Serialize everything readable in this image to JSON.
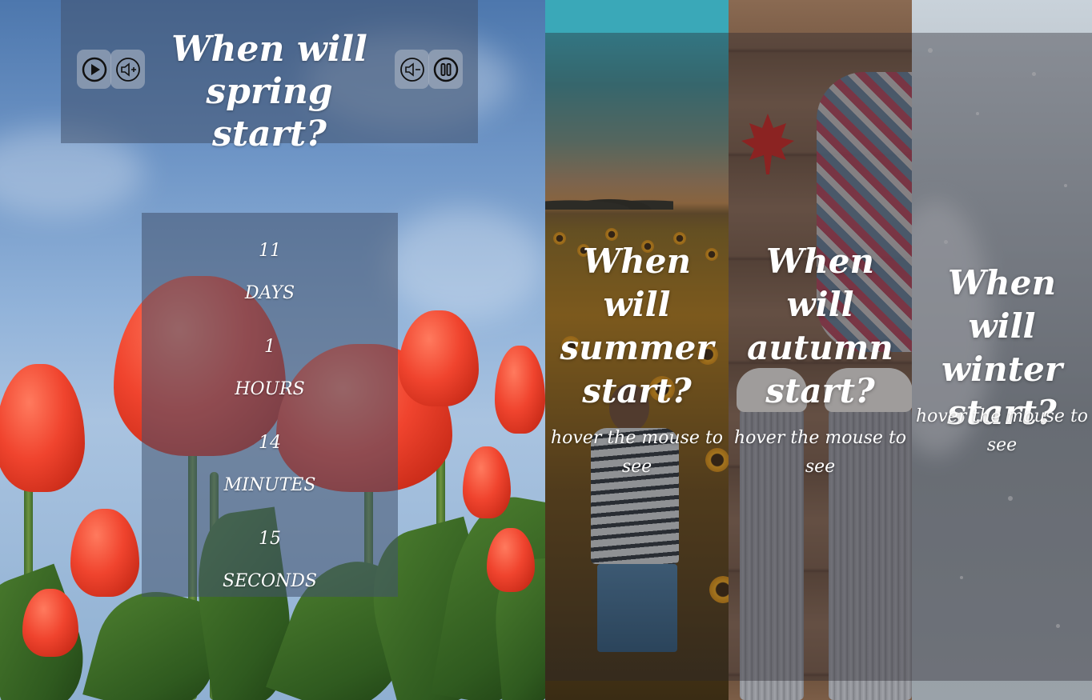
{
  "spring": {
    "title": "When will spring start?",
    "controls": {
      "play_icon": "play-icon",
      "volume_up_icon": "volume-up-icon",
      "volume_down_icon": "volume-down-icon",
      "pause_icon": "pause-icon"
    },
    "countdown": {
      "days_value": "11",
      "days_label": "DAYS",
      "hours_value": "1",
      "hours_label": "HOURS",
      "minutes_value": "14",
      "minutes_label": "MINUTES",
      "seconds_value": "15",
      "seconds_label": "SECONDS"
    }
  },
  "summer": {
    "title": "When will summer start?",
    "hint": "hover the mouse to see"
  },
  "autumn": {
    "title": "When will autumn start?",
    "hint": "hover the mouse to see"
  },
  "winter": {
    "title": "When will winter start?",
    "hint": "hover the mouse to see"
  },
  "colors": {
    "overlay": "#42526e",
    "button_bg": "#aab4c3",
    "text": "#ffffff"
  }
}
